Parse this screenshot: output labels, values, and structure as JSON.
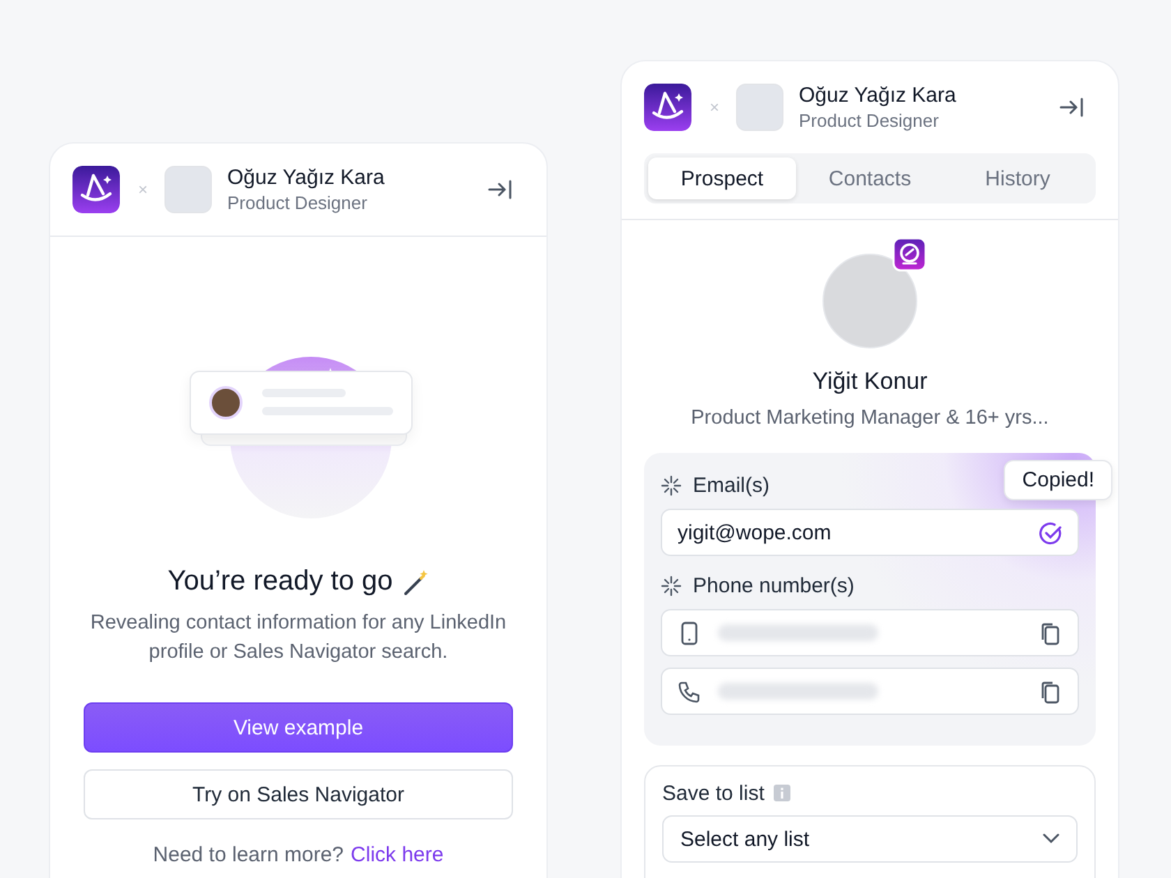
{
  "left_panel": {
    "header": {
      "separator": "×",
      "user_name": "Oğuz Yağız Kara",
      "user_role": "Product Designer"
    },
    "title": "You’re ready to go",
    "description": "Revealing contact information for any LinkedIn profile or Sales Navigator search.",
    "buttons": [
      {
        "label": "View example",
        "kind": "primary"
      },
      {
        "label": "Try on Sales Navigator",
        "kind": "secondary"
      }
    ],
    "help_text": "Need to learn more?",
    "help_link": "Click here"
  },
  "right_panel": {
    "header": {
      "separator": "×",
      "user_name": "Oğuz Yağız Kara",
      "user_role": "Product Designer"
    },
    "tabs": [
      {
        "label": "Prospect",
        "selected": true
      },
      {
        "label": "Contacts",
        "selected": false
      },
      {
        "label": "History",
        "selected": false
      }
    ],
    "profile": {
      "name": "Yiğit Konur",
      "headline": "Product Marketing Manager & 16+ yrs..."
    },
    "contact": {
      "email_label": "Email(s)",
      "emails": [
        {
          "value": "yigit@wope.com",
          "copied": true
        }
      ],
      "tooltip": "Copied!",
      "phone_label": "Phone number(s)",
      "phones": [
        {
          "kind": "mobile"
        },
        {
          "kind": "landline"
        }
      ]
    },
    "save": {
      "label": "Save to list",
      "select_placeholder": "Select any list"
    }
  }
}
